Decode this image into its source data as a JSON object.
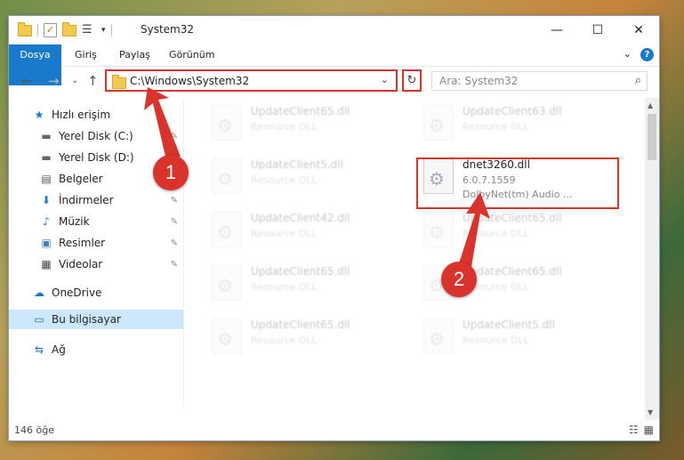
{
  "window": {
    "title": "System32",
    "controls": {
      "minimize": "—",
      "maximize": "☐",
      "close": "✕"
    }
  },
  "ribbon": {
    "tabs": [
      "Dosya",
      "Giriş",
      "Paylaş",
      "Görünüm"
    ],
    "expand": "⌄",
    "help": "?"
  },
  "navigation": {
    "back": "←",
    "forward": "→",
    "recent": "⌄",
    "up": "↑",
    "address": "C:\\Windows\\System32",
    "address_dropdown": "⌄",
    "refresh": "↻",
    "search_placeholder": "Ara: System32",
    "search_icon": "⌕"
  },
  "sidebar": {
    "items": [
      {
        "label": "Hızlı erişim",
        "icon": "★"
      },
      {
        "label": "Yerel Disk (C:)",
        "icon": "▬"
      },
      {
        "label": "Yerel Disk (D:)",
        "icon": "▬"
      },
      {
        "label": "Belgeler",
        "icon": "▤"
      },
      {
        "label": "İndirmeler",
        "icon": "⬇"
      },
      {
        "label": "Müzik",
        "icon": "♪"
      },
      {
        "label": "Resimler",
        "icon": "▣"
      },
      {
        "label": "Videolar",
        "icon": "▦"
      },
      {
        "label": "OneDrive",
        "icon": "☁"
      },
      {
        "label": "Bu bilgisayar",
        "icon": "▭"
      },
      {
        "label": "Ağ",
        "icon": "⇆"
      }
    ],
    "pin_icon": "📌"
  },
  "files": [
    {
      "name": "UpdateClient65.dll",
      "desc": "Resource DLL"
    },
    {
      "name": "UpdateClient63.dll",
      "desc": "Resource DLL"
    },
    {
      "name": "UpdateClient5.dll",
      "desc": "Resource DLL"
    },
    {
      "name": "dnet3260.dll",
      "version": "6.0.7.1559",
      "desc": "DolbyNet(tm) Audio ..."
    },
    {
      "name": "UpdateClient42.dll",
      "desc": "Resource DLL"
    },
    {
      "name": "UpdateClient65.dll",
      "desc": "Resource DLL"
    },
    {
      "name": "UpdateClient65.dll",
      "desc": "Resource DLL"
    },
    {
      "name": "UpdateClient65.dll",
      "desc": "Resource DLL"
    },
    {
      "name": "UpdateClient65.dll",
      "desc": "Resource DLL"
    },
    {
      "name": "UpdateClient5.dll",
      "desc": "Resource DLL"
    }
  ],
  "status": {
    "item_count": "146 öğe",
    "view_details": "☷",
    "view_icons": "▦"
  },
  "annotations": {
    "step1": "1",
    "step2": "2",
    "color": "#d9332b"
  }
}
